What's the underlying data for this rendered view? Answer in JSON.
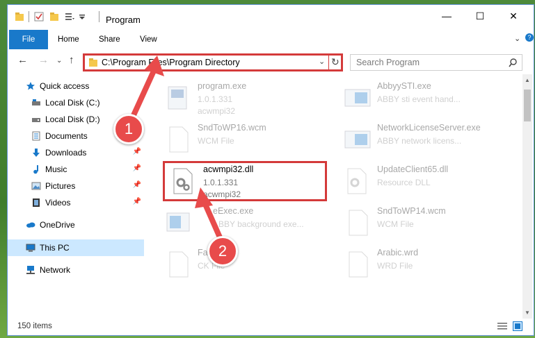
{
  "window": {
    "title": "Program",
    "controls": {
      "minimize": "—",
      "maximize": "☐",
      "close": "✕"
    }
  },
  "ribbon": {
    "tabs": [
      "File",
      "Home",
      "Share",
      "View"
    ]
  },
  "address": {
    "path": "C:\\Program Files\\Program Directory",
    "search_placeholder": "Search Program"
  },
  "nav": {
    "items": [
      {
        "label": "Quick access",
        "icon": "star-icon"
      },
      {
        "label": "Local Disk (C:)",
        "icon": "drive-icon"
      },
      {
        "label": "Local Disk (D:)",
        "icon": "drive-icon"
      },
      {
        "label": "Documents",
        "icon": "documents-icon"
      },
      {
        "label": "Downloads",
        "icon": "download-icon"
      },
      {
        "label": "Music",
        "icon": "music-icon"
      },
      {
        "label": "Pictures",
        "icon": "pictures-icon"
      },
      {
        "label": "Videos",
        "icon": "videos-icon"
      },
      {
        "label": "OneDrive",
        "icon": "cloud-icon"
      },
      {
        "label": "This PC",
        "icon": "computer-icon"
      },
      {
        "label": "Network",
        "icon": "network-icon"
      }
    ]
  },
  "files": {
    "left": [
      {
        "name": "program.exe",
        "line1": "1.0.1.331",
        "line2": "acwmpi32"
      },
      {
        "name": "SndToWP16.wcm",
        "line1": "WCM File",
        "line2": ""
      },
      {
        "name": "acwmpi32.dll",
        "line1": "1.0.1.331",
        "line2": "acwmpi32"
      },
      {
        "name": "eExec.exe",
        "line1": "BBY background exe...",
        "line2": ""
      },
      {
        "name": "Fas...k",
        "line1": "CK File",
        "line2": ""
      }
    ],
    "right": [
      {
        "name": "AbbyySTI.exe",
        "line1": "ABBY sti event hand...",
        "line2": ""
      },
      {
        "name": "NetworkLicenseServer.exe",
        "line1": "ABBY network licens...",
        "line2": ""
      },
      {
        "name": "UpdateClient65.dll",
        "line1": "Resource DLL",
        "line2": ""
      },
      {
        "name": "SndToWP14.wcm",
        "line1": "WCM File",
        "line2": ""
      },
      {
        "name": "Arabic.wrd",
        "line1": "WRD File",
        "line2": ""
      }
    ]
  },
  "status": {
    "items": "150 items"
  },
  "callouts": [
    "1",
    "2"
  ],
  "colors": {
    "accent": "#1979ca",
    "highlight": "#d43a3a",
    "selected": "#cce8ff"
  }
}
